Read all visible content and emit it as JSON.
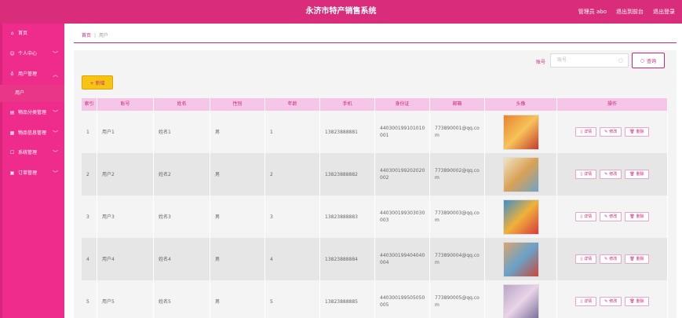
{
  "header": {
    "title": "永济市特产销售系统",
    "admin_label": "管理员 abo",
    "back_label": "退出到前台",
    "logout_label": "退出登录"
  },
  "sidebar": {
    "items": [
      {
        "label": "首页",
        "icon": "home-icon",
        "has_chevron": false
      },
      {
        "label": "个人中心",
        "icon": "user-icon",
        "has_chevron": true
      },
      {
        "label": "用户管理",
        "icon": "users-icon",
        "has_chevron": true,
        "expanded": true
      },
      {
        "label": "物品分类管理",
        "icon": "category-icon",
        "has_chevron": true
      },
      {
        "label": "物品信息管理",
        "icon": "info-icon",
        "has_chevron": true
      },
      {
        "label": "系统管理",
        "icon": "settings-icon",
        "has_chevron": true
      },
      {
        "label": "订单管理",
        "icon": "order-icon",
        "has_chevron": true
      }
    ],
    "sub_item": "用户"
  },
  "breadcrumb": {
    "home": "首页",
    "sep": "|",
    "current": "用户"
  },
  "search": {
    "label": "账号",
    "placeholder": "账号",
    "button": "查询"
  },
  "add_button": "+ 新增",
  "table": {
    "headers": [
      "索引",
      "账号",
      "姓名",
      "性别",
      "年龄",
      "手机",
      "身份证",
      "邮箱",
      "头像",
      "操作"
    ],
    "rows": [
      {
        "index": "1",
        "account": "用户1",
        "name": "姓名1",
        "gender": "男",
        "age": "1",
        "phone": "13823888881",
        "idcard": "440300199101010001",
        "email": "773890001@qq.com",
        "thumb_colors": [
          "#e7832e",
          "#f7c35a",
          "#c13b2a"
        ]
      },
      {
        "index": "2",
        "account": "用户2",
        "name": "姓名2",
        "gender": "男",
        "age": "2",
        "phone": "13823888882",
        "idcard": "440300199202020002",
        "email": "773890002@qq.com",
        "thumb_colors": [
          "#f2e3c7",
          "#d8a255",
          "#6fa3c8"
        ]
      },
      {
        "index": "3",
        "account": "用户3",
        "name": "姓名3",
        "gender": "男",
        "age": "3",
        "phone": "13823888883",
        "idcard": "440300199303030003",
        "email": "773890003@qq.com",
        "thumb_colors": [
          "#3e8fc9",
          "#f0b13a",
          "#d63c3c"
        ]
      },
      {
        "index": "4",
        "account": "用户4",
        "name": "姓名4",
        "gender": "男",
        "age": "4",
        "phone": "13823888884",
        "idcard": "440300199404040004",
        "email": "773890004@qq.com",
        "thumb_colors": [
          "#dba46b",
          "#6aa2c9",
          "#c64a3a"
        ]
      },
      {
        "index": "5",
        "account": "用户5",
        "name": "姓名5",
        "gender": "男",
        "age": "5",
        "phone": "13823888885",
        "idcard": "440300199505050005",
        "email": "773890005@qq.com",
        "thumb_colors": [
          "#b9a6c7",
          "#e9d4e8",
          "#7b6f9a"
        ]
      }
    ],
    "actions": {
      "detail": "详情",
      "edit": "修改",
      "delete": "删除"
    }
  },
  "colors": {
    "accent": "#d92d7c",
    "sidebar": "#ef2c8c",
    "add_button": "#f6c514",
    "header_row": "#f6c6e8",
    "row_even": "#e6e6e6",
    "row_odd": "#f4f4f4"
  }
}
